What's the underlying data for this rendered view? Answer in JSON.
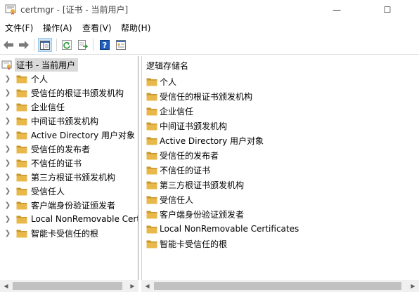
{
  "window": {
    "title": "certmgr - [证书 - 当前用户]",
    "min_glyph": "—",
    "max_glyph": "☐"
  },
  "menu": [
    "文件(F)",
    "操作(A)",
    "查看(V)",
    "帮助(H)"
  ],
  "toolbar": {
    "buttons": [
      "back-icon",
      "forward-icon",
      "show-hide-tree-icon",
      "refresh-icon",
      "export-list-icon",
      "help-icon",
      "properties-icon"
    ],
    "active": "show-hide-tree-icon"
  },
  "tree": {
    "root_label": "证书 - 当前用户",
    "items": [
      "个人",
      "受信任的根证书颁发机构",
      "企业信任",
      "中间证书颁发机构",
      "Active Directory 用户对象",
      "受信任的发布者",
      "不信任的证书",
      "第三方根证书颁发机构",
      "受信任人",
      "客户端身份验证颁发者",
      "Local NonRemovable Certificates",
      "智能卡受信任的根"
    ],
    "expand_glyph": "❯"
  },
  "list": {
    "column_header": "逻辑存储名",
    "items": [
      "个人",
      "受信任的根证书颁发机构",
      "企业信任",
      "中间证书颁发机构",
      "Active Directory 用户对象",
      "受信任的发布者",
      "不信任的证书",
      "第三方根证书颁发机构",
      "受信任人",
      "客户端身份验证颁发者",
      "Local NonRemovable Certificates",
      "智能卡受信任的根"
    ]
  },
  "scrollbar_glyphs": {
    "left": "◀",
    "right": "▶"
  },
  "colors": {
    "folder": "#e8b84a",
    "folder_dark": "#c9962b",
    "selection": "#d9d9d9",
    "toolbar_active": "#cce4f7"
  }
}
